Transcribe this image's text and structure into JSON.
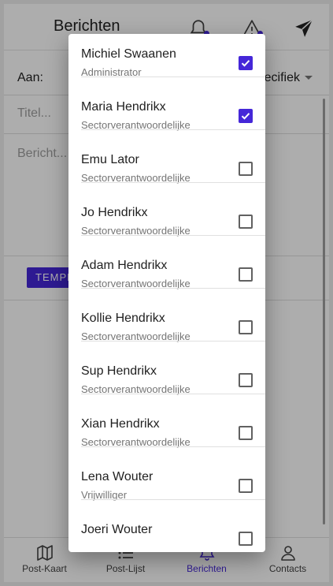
{
  "header": {
    "title": "Berichten",
    "icons": [
      "bell-icon",
      "warning-icon",
      "send-icon"
    ],
    "badge_color": "#4527d8"
  },
  "form": {
    "to_label": "Aan:",
    "recipient_mode": "ecifiek",
    "title_placeholder": "Titel...",
    "message_placeholder": "Bericht...",
    "template_button": "TEMPLATE"
  },
  "bottom_nav": {
    "items": [
      {
        "label": "Post-Kaart",
        "icon": "map-icon"
      },
      {
        "label": "Post-Lijst",
        "icon": "list-icon"
      },
      {
        "label": "Berichten",
        "icon": "bell-icon",
        "active": true
      },
      {
        "label": "Contacts",
        "icon": "person-icon"
      }
    ],
    "active_color": "#4527d8"
  },
  "dialog": {
    "contacts": [
      {
        "name": "Michiel Swaanen",
        "role": "Administrator",
        "checked": true
      },
      {
        "name": "Maria Hendrikx",
        "role": "Sectorverantwoordelijke",
        "checked": true
      },
      {
        "name": "Emu Lator",
        "role": "Sectorverantwoordelijke",
        "checked": false
      },
      {
        "name": "Jo Hendrikx",
        "role": "Sectorverantwoordelijke",
        "checked": false
      },
      {
        "name": "Adam Hendrikx",
        "role": "Sectorverantwoordelijke",
        "checked": false
      },
      {
        "name": "Kollie Hendrikx",
        "role": "Sectorverantwoordelijke",
        "checked": false
      },
      {
        "name": "Sup Hendrikx",
        "role": "Sectorverantwoordelijke",
        "checked": false
      },
      {
        "name": "Xian Hendrikx",
        "role": "Sectorverantwoordelijke",
        "checked": false
      },
      {
        "name": "Lena Wouter",
        "role": "Vrijwilliger",
        "checked": false
      },
      {
        "name": "Joeri Wouter",
        "role": "",
        "checked": false
      }
    ],
    "checkbox_color": "#4527d8"
  }
}
